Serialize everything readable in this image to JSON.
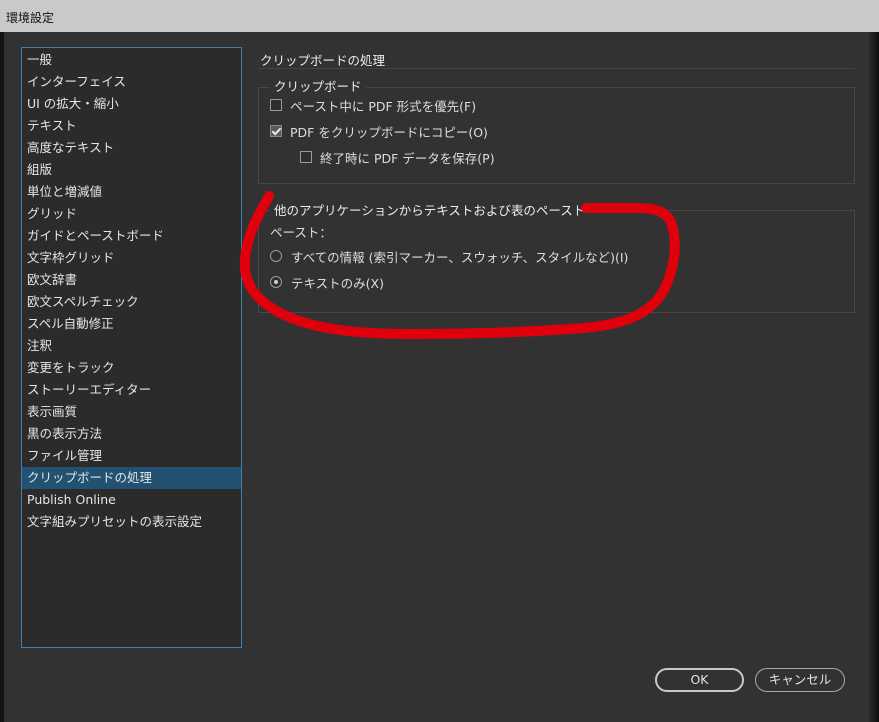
{
  "window": {
    "title": "環境設定"
  },
  "sidebar": {
    "items": [
      {
        "label": "一般",
        "selected": false
      },
      {
        "label": "インターフェイス",
        "selected": false
      },
      {
        "label": "UI の拡大・縮小",
        "selected": false
      },
      {
        "label": "テキスト",
        "selected": false
      },
      {
        "label": "高度なテキスト",
        "selected": false
      },
      {
        "label": "組版",
        "selected": false
      },
      {
        "label": "単位と増減値",
        "selected": false
      },
      {
        "label": "グリッド",
        "selected": false
      },
      {
        "label": "ガイドとペーストボード",
        "selected": false
      },
      {
        "label": "文字枠グリッド",
        "selected": false
      },
      {
        "label": "欧文辞書",
        "selected": false
      },
      {
        "label": "欧文スペルチェック",
        "selected": false
      },
      {
        "label": "スペル自動修正",
        "selected": false
      },
      {
        "label": "注釈",
        "selected": false
      },
      {
        "label": "変更をトラック",
        "selected": false
      },
      {
        "label": "ストーリーエディター",
        "selected": false
      },
      {
        "label": "表示画質",
        "selected": false
      },
      {
        "label": "黒の表示方法",
        "selected": false
      },
      {
        "label": "ファイル管理",
        "selected": false
      },
      {
        "label": "クリップボードの処理",
        "selected": true
      },
      {
        "label": "Publish Online",
        "selected": false
      },
      {
        "label": "文字組みプリセットの表示設定",
        "selected": false
      }
    ]
  },
  "main": {
    "section_title": "クリップボードの処理",
    "clipboard_group": {
      "legend": "クリップボード",
      "prefer_pdf": {
        "label": "ペースト中に PDF 形式を優先(F)",
        "checked": false
      },
      "copy_pdf": {
        "label": "PDF をクリップボードにコピー(O)",
        "checked": true
      },
      "preserve_pdf": {
        "label": "終了時に PDF データを保存(P)",
        "checked": false
      }
    },
    "paste_group": {
      "legend": "他のアプリケーションからテキストおよび表のペースト",
      "paste_label": "ペースト：",
      "all_info": {
        "label": "すべての情報 (索引マーカー、スウォッチ、スタイルなど)(I)",
        "selected": false
      },
      "text_only": {
        "label": "テキストのみ(X)",
        "selected": true
      }
    }
  },
  "buttons": {
    "ok": "OK",
    "cancel": "キャンセル"
  },
  "colors": {
    "panel_bg": "#323232",
    "selection": "#235171",
    "sidebar_border": "#3f7fb0",
    "annotation": "#e0000c"
  }
}
